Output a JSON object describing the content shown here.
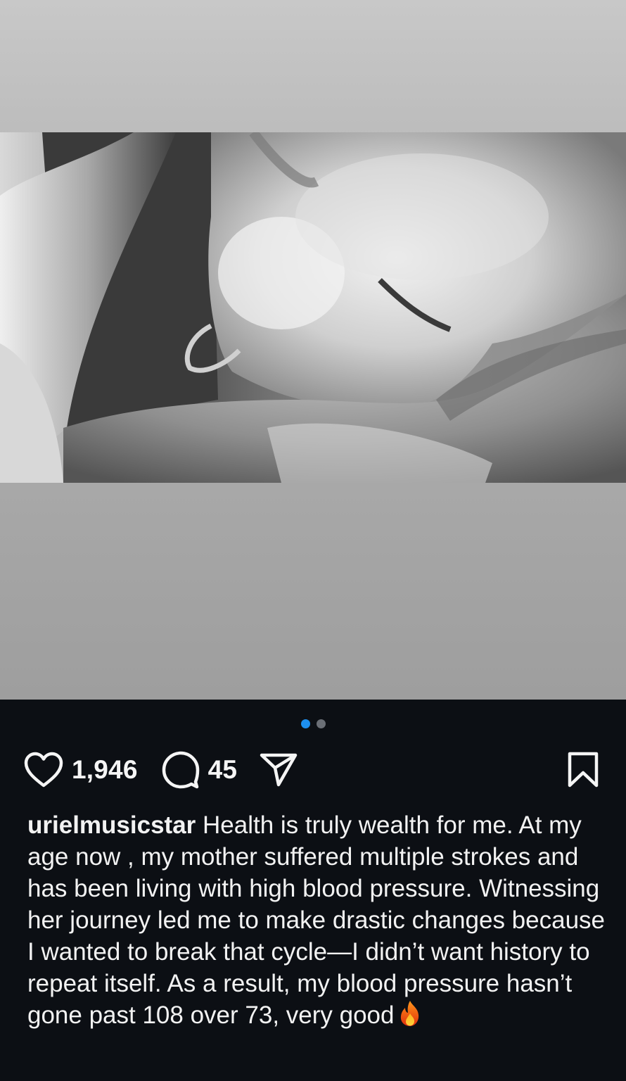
{
  "carousel": {
    "total": 2,
    "active_index": 0
  },
  "actions": {
    "like_count": "1,946",
    "comment_count": "45",
    "icons": [
      "heart-icon",
      "comment-icon",
      "share-icon",
      "bookmark-icon"
    ]
  },
  "caption": {
    "username": "urielmusicstar",
    "text": " Health is truly wealth for me. At my age now , my mother suffered multiple strokes and has been living with high blood pressure. Witnessing her journey led me to make drastic changes because I wanted to break that cycle—I didn’t want history to repeat itself. As a result, my blood pressure hasn’t gone past 108 over 73, very good",
    "emoji": "fire-emoji"
  },
  "colors": {
    "background": "#0c0f14",
    "text": "#f2f2f2",
    "dot_active": "#1d8ff0",
    "dot_inactive": "#6b6f76"
  }
}
